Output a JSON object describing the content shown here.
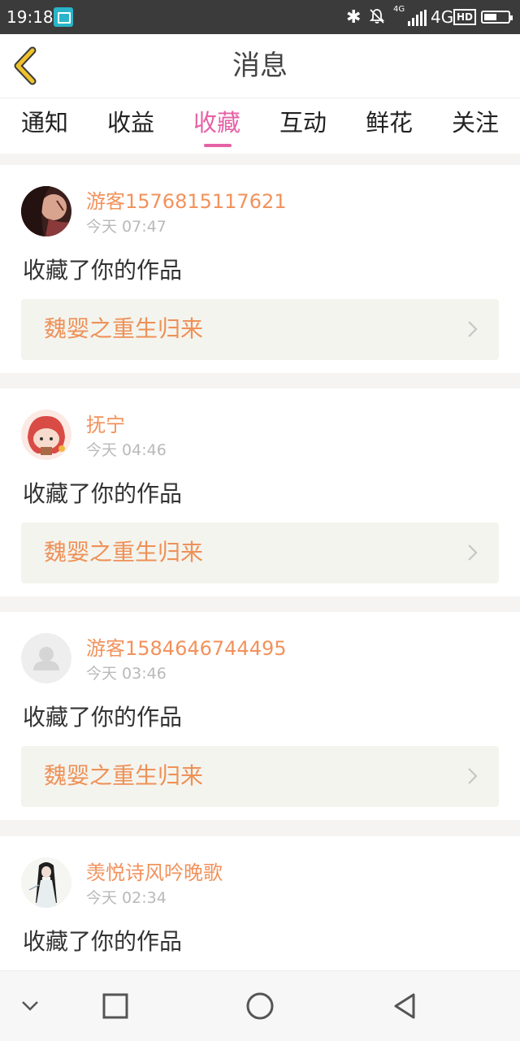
{
  "status_bar": {
    "time": "19:18",
    "network_small": "4G",
    "network": "4G",
    "hd": "HD",
    "icons": [
      "screenshot-icon",
      "bluetooth-icon",
      "bell-off-icon",
      "signal-icon",
      "battery-icon"
    ]
  },
  "header": {
    "title": "消息",
    "back_icon": "chevron-left-icon"
  },
  "tabs": [
    {
      "label": "通知",
      "active": false
    },
    {
      "label": "收益",
      "active": false
    },
    {
      "label": "收藏",
      "active": true
    },
    {
      "label": "互动",
      "active": false
    },
    {
      "label": "鲜花",
      "active": false
    },
    {
      "label": "关注",
      "active": false
    }
  ],
  "messages": [
    {
      "user": "游客1576815117621",
      "time": "今天 07:47",
      "action": "收藏了你的作品",
      "work": "魏婴之重生归来"
    },
    {
      "user": "抚宁",
      "time": "今天 04:46",
      "action": "收藏了你的作品",
      "work": "魏婴之重生归来"
    },
    {
      "user": "游客1584646744495",
      "time": "今天 03:46",
      "action": "收藏了你的作品",
      "work": "魏婴之重生归来"
    },
    {
      "user": "羡悦诗风吟晚歌",
      "time": "今天 02:34",
      "action": "收藏了你的作品",
      "work": ""
    }
  ],
  "colors": {
    "accent_pink": "#e562a6",
    "username_orange": "#f2925c",
    "work_title_orange": "#ee9158",
    "back_arrow_yellow": "#f0c22a"
  },
  "nav_bar": {
    "icons": [
      "chevron-down-icon",
      "square-recents-icon",
      "circle-home-icon",
      "triangle-back-icon"
    ]
  }
}
